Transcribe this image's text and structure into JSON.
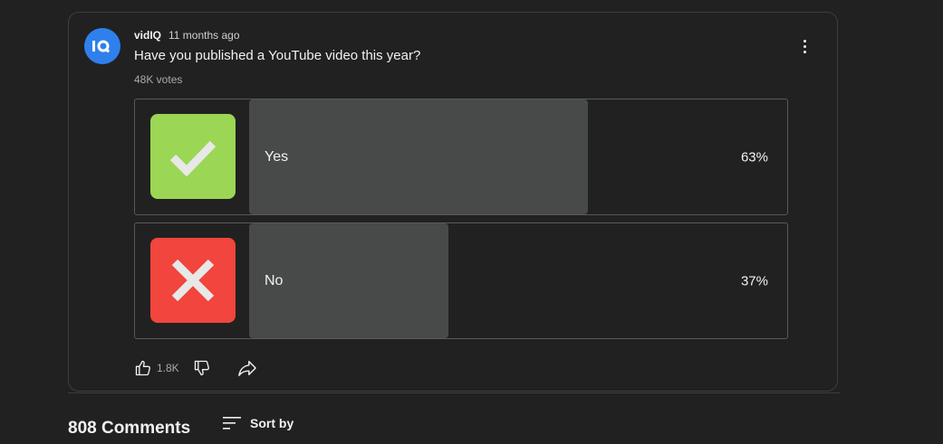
{
  "post": {
    "author": "vidIQ",
    "time": "11 months ago",
    "question": "Have you published a YouTube video this year?",
    "votes": "48K votes",
    "avatar_icon": "vidiq-logo-icon",
    "avatar_color": "#2f80ed"
  },
  "poll": {
    "options": [
      {
        "label": "Yes",
        "percent_text": "63%",
        "percent": 63,
        "icon": "checkmark-icon",
        "icon_bg": "#9bd654"
      },
      {
        "label": "No",
        "percent_text": "37%",
        "percent": 37,
        "icon": "x-mark-icon",
        "icon_bg": "#f1453d"
      }
    ],
    "fill_color": "#484a49"
  },
  "actions": {
    "like_count": "1.8K",
    "like_icon": "thumbs-up-icon",
    "dislike_icon": "thumbs-down-icon",
    "share_icon": "share-icon"
  },
  "comments": {
    "count_label": "808 Comments",
    "sort_label": "Sort by",
    "sort_icon": "sort-icon"
  },
  "menu": {
    "icon": "more-vertical-icon"
  }
}
